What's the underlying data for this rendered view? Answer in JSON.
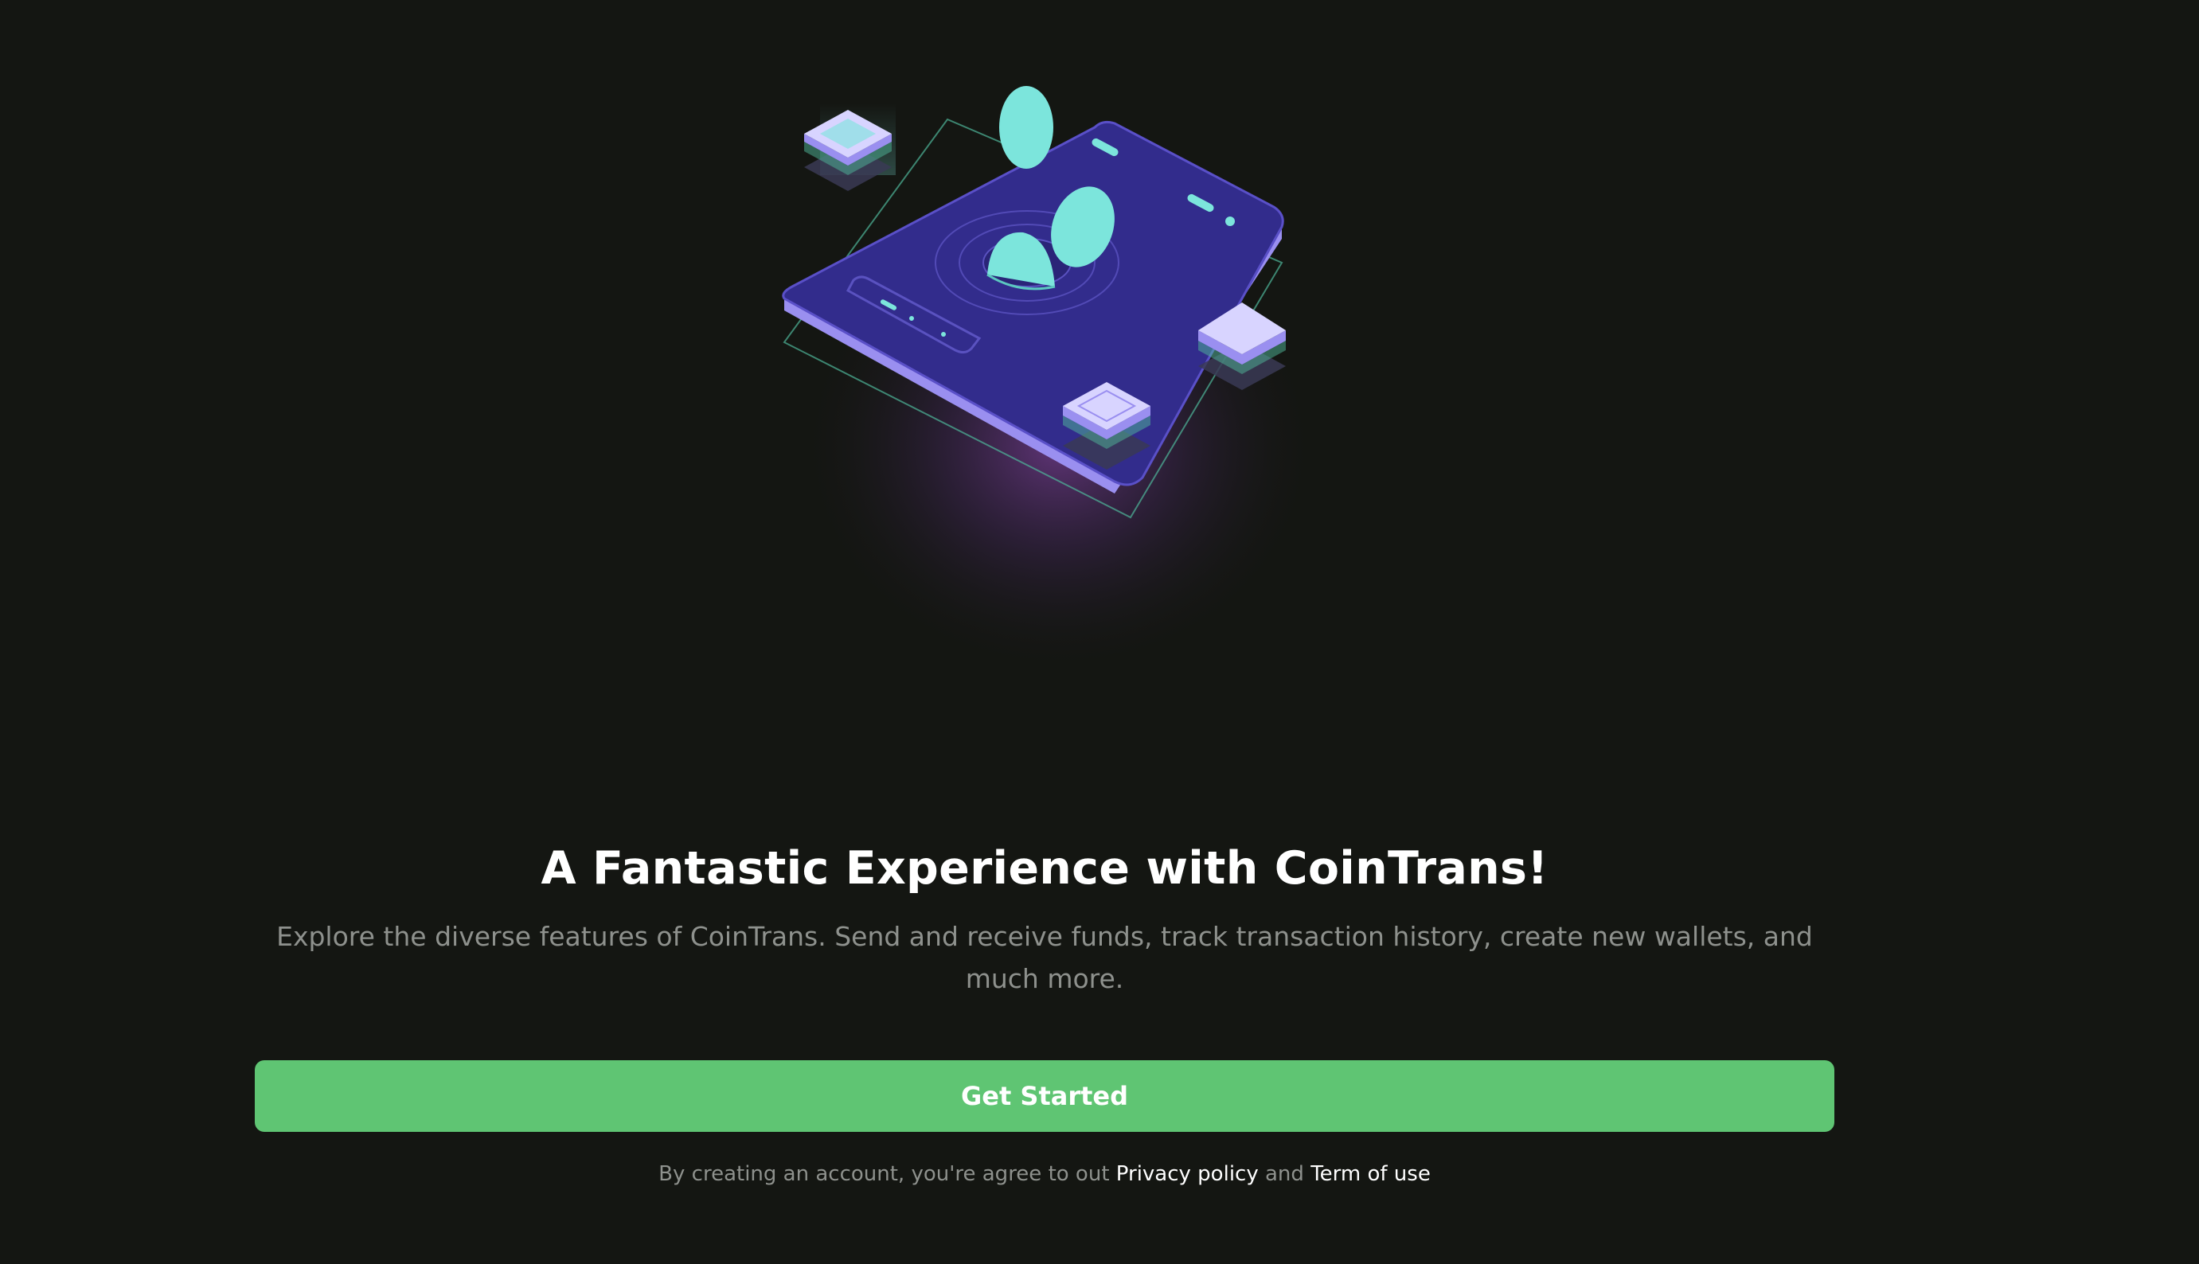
{
  "hero": {
    "illustration": "phone-with-coins-icon"
  },
  "onboarding": {
    "title": "A Fantastic Experience with CoinTrans!",
    "description": "Explore the diverse features of CoinTrans. Send and receive funds, track transaction history, create new wallets, and much more.",
    "cta_label": "Get Started",
    "terms_prefix": "By creating an account, you're agree to out",
    "privacy_link": "Privacy policy",
    "terms_and": "and",
    "terms_link": "Term of use"
  },
  "colors": {
    "background": "#141612",
    "accent": "#5fc573",
    "phone": "#2e2a86",
    "coin": "#7ce5dc"
  }
}
